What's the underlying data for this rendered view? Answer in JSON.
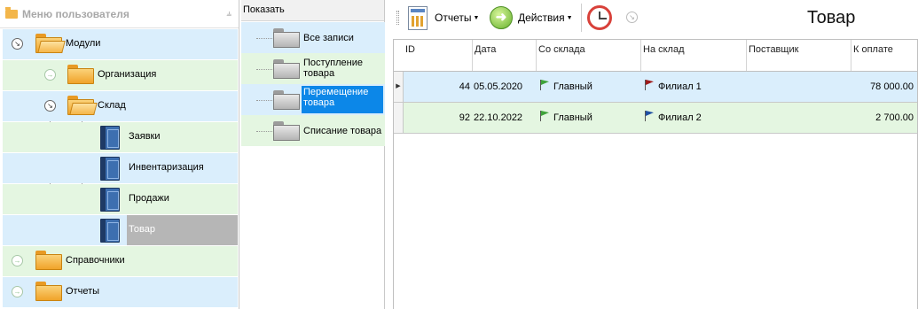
{
  "left_panel": {
    "title": "Меню пользователя",
    "pin_icon": "pin-icon",
    "tree": [
      {
        "label": "Модули",
        "icon": "folder-open-icon",
        "expanded": true
      },
      {
        "label": "Организация",
        "icon": "folder-icon",
        "expanded": false
      },
      {
        "label": "Склад",
        "icon": "folder-open-icon",
        "expanded": true
      },
      {
        "label": "Заявки",
        "icon": "book-icon"
      },
      {
        "label": "Инвентаризация",
        "icon": "book-icon"
      },
      {
        "label": "Продажи",
        "icon": "book-icon"
      },
      {
        "label": "Товар",
        "icon": "book-icon",
        "selected": true
      },
      {
        "label": "Справочники",
        "icon": "folder-icon",
        "expanded": false
      },
      {
        "label": "Отчеты",
        "icon": "folder-icon",
        "expanded": false
      }
    ]
  },
  "filter_panel": {
    "title": "Показать",
    "items": [
      {
        "label": "Все записи"
      },
      {
        "label": "Поступление товара"
      },
      {
        "label": "Перемещение товара",
        "selected": true
      },
      {
        "label": "Списание товара"
      }
    ]
  },
  "toolbar": {
    "reports_label": "Отчеты",
    "actions_label": "Действия"
  },
  "page_title": "Товар",
  "grid": {
    "columns": [
      "ID",
      "Дата",
      "Со склада",
      "На склад",
      "Поставщик",
      "К оплате"
    ],
    "rows": [
      {
        "id": "44",
        "date": "05.05.2020",
        "from": "Главный",
        "from_flag": "#3fa33a",
        "to": "Филиал 1",
        "to_flag": "#9e1b1b",
        "supplier": "",
        "amount": "78 000.00"
      },
      {
        "id": "92",
        "date": "22.10.2022",
        "from": "Главный",
        "from_flag": "#3fa33a",
        "to": "Филиал 2",
        "to_flag": "#1f4fa3",
        "supplier": "",
        "amount": "2 700.00"
      }
    ]
  },
  "colors": {
    "row_blue": "#daeefc",
    "row_green": "#e4f6e1",
    "selection": "#0c87e8"
  }
}
